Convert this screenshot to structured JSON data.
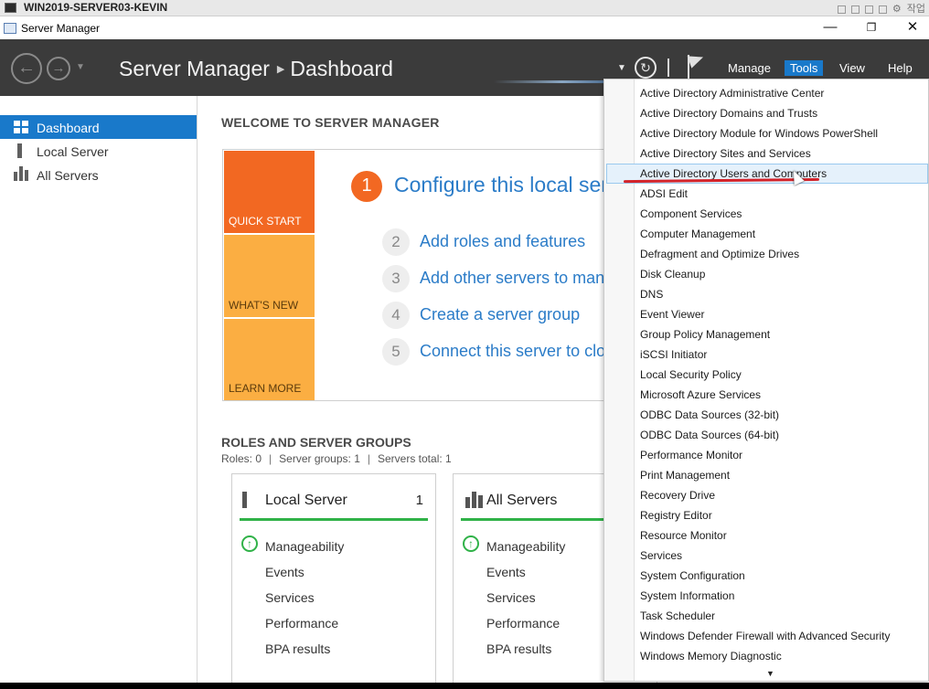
{
  "vm": {
    "title": "WIN2019-SERVER03-KEVIN",
    "controls_text": "작업"
  },
  "window": {
    "title": "Server Manager",
    "minimize": "—",
    "restore": "❐",
    "close": "✕"
  },
  "header": {
    "app": "Server Manager",
    "page": "Dashboard",
    "menus": [
      "Manage",
      "Tools",
      "View",
      "Help"
    ],
    "active_menu": "Tools"
  },
  "sidebar": {
    "items": [
      {
        "label": "Dashboard",
        "icon": "dashboard-icon",
        "active": true
      },
      {
        "label": "Local Server",
        "icon": "server-icon"
      },
      {
        "label": "All Servers",
        "icon": "servers-icon"
      }
    ]
  },
  "welcome": {
    "heading": "WELCOME TO SERVER MANAGER",
    "tiles": [
      "QUICK START",
      "WHAT'S NEW",
      "LEARN MORE"
    ],
    "steps": [
      {
        "num": "1",
        "label": "Configure this local ser"
      },
      {
        "num": "2",
        "label": "Add roles and features"
      },
      {
        "num": "3",
        "label": "Add other servers to man"
      },
      {
        "num": "4",
        "label": "Create a server group"
      },
      {
        "num": "5",
        "label": "Connect this server to clo"
      }
    ]
  },
  "roles": {
    "heading": "ROLES AND SERVER GROUPS",
    "summary": {
      "roles": "Roles: 0",
      "groups": "Server groups: 1",
      "total": "Servers total: 1"
    },
    "cards": [
      {
        "title": "Local Server",
        "count": "1",
        "rows": [
          "Manageability",
          "Events",
          "Services",
          "Performance",
          "BPA results"
        ]
      },
      {
        "title": "All Servers",
        "count": "",
        "rows": [
          "Manageability",
          "Events",
          "Services",
          "Performance",
          "BPA results"
        ]
      }
    ]
  },
  "tools_menu": {
    "highlighted": "Active Directory Users and Computers",
    "items": [
      "Active Directory Administrative Center",
      "Active Directory Domains and Trusts",
      "Active Directory Module for Windows PowerShell",
      "Active Directory Sites and Services",
      "Active Directory Users and Computers",
      "ADSI Edit",
      "Component Services",
      "Computer Management",
      "Defragment and Optimize Drives",
      "Disk Cleanup",
      "DNS",
      "Event Viewer",
      "Group Policy Management",
      "iSCSI Initiator",
      "Local Security Policy",
      "Microsoft Azure Services",
      "ODBC Data Sources (32-bit)",
      "ODBC Data Sources (64-bit)",
      "Performance Monitor",
      "Print Management",
      "Recovery Drive",
      "Registry Editor",
      "Resource Monitor",
      "Services",
      "System Configuration",
      "System Information",
      "Task Scheduler",
      "Windows Defender Firewall with Advanced Security",
      "Windows Memory Diagnostic"
    ]
  },
  "colors": {
    "accent": "#1979ca",
    "orange": "#f26822",
    "amber": "#fbae42",
    "ok_green": "#30b248",
    "header_bg": "#3b3b3b"
  }
}
